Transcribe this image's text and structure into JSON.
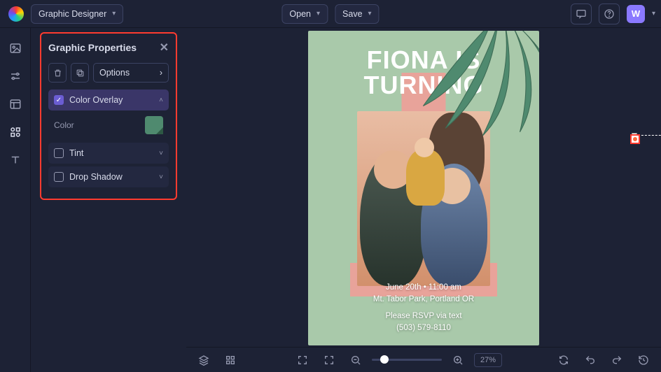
{
  "topbar": {
    "title": "Graphic Designer",
    "open_label": "Open",
    "save_label": "Save",
    "avatar_initial": "W"
  },
  "sidebar": {},
  "panel": {
    "title": "Graphic Properties",
    "options_label": "Options",
    "sections": {
      "color_overlay": {
        "label": "Color Overlay",
        "color_label": "Color"
      },
      "tint": {
        "label": "Tint"
      },
      "drop_shadow": {
        "label": "Drop Shadow"
      }
    }
  },
  "canvas": {
    "headline_line1": "FIONA IS",
    "headline_line2": "TURNING",
    "info_line1": "June 20th • 11:00 am",
    "info_line2": "Mt. Tabor Park, Portland OR",
    "info_line3": "Please RSVP via text",
    "info_line4": "(503) 579-8110"
  },
  "bottombar": {
    "zoom_label": "27%"
  }
}
